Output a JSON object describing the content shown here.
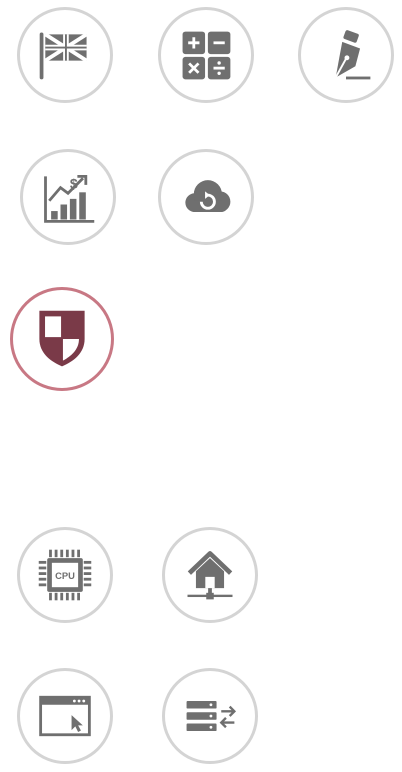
{
  "icon_grid": {
    "items": [
      {
        "icon": "flag-icon",
        "active": false
      },
      {
        "icon": "calculator-icon",
        "active": false
      },
      {
        "icon": "pen-nib-icon",
        "active": false
      },
      {
        "icon": "finance-growth-icon",
        "active": false
      },
      {
        "icon": "cloud-sync-icon",
        "active": false
      },
      {
        "icon": "shield-icon",
        "active": true
      },
      {
        "icon": "cpu-chip-icon",
        "active": false,
        "label": "CPU"
      },
      {
        "icon": "home-network-icon",
        "active": false
      },
      {
        "icon": "browser-cursor-icon",
        "active": false
      },
      {
        "icon": "server-transfer-icon",
        "active": false
      }
    ]
  },
  "colors": {
    "icon_gray": "#6f6f6f",
    "ring_gray": "#d4d4d4",
    "active_ring": "#c87884",
    "active_icon": "#7a3a48"
  }
}
